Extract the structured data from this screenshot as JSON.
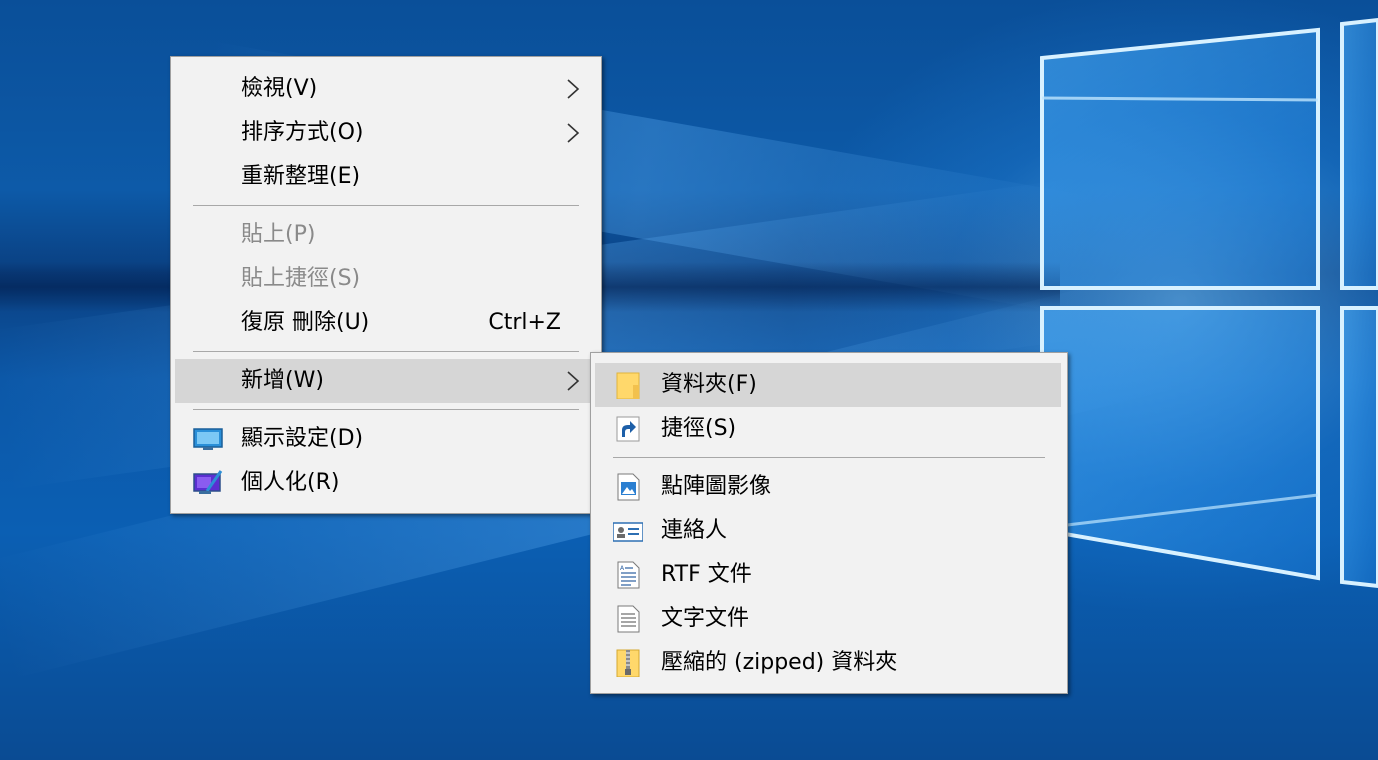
{
  "main_menu": {
    "items": [
      {
        "label": "檢視(V)",
        "has_submenu": true
      },
      {
        "label": "排序方式(O)",
        "has_submenu": true
      },
      {
        "label": "重新整理(E)"
      },
      {
        "label": "貼上(P)",
        "disabled": true
      },
      {
        "label": "貼上捷徑(S)",
        "disabled": true
      },
      {
        "label": "復原 刪除(U)",
        "shortcut": "Ctrl+Z"
      },
      {
        "label": "新增(W)",
        "has_submenu": true,
        "highlighted": true
      },
      {
        "label": "顯示設定(D)",
        "icon": "display-settings-icon"
      },
      {
        "label": "個人化(R)",
        "icon": "personalize-icon"
      }
    ]
  },
  "new_submenu": {
    "items": [
      {
        "label": "資料夾(F)",
        "icon": "folder-icon",
        "highlighted": true
      },
      {
        "label": "捷徑(S)",
        "icon": "shortcut-icon"
      },
      {
        "label": "點陣圖影像",
        "icon": "bitmap-image-icon"
      },
      {
        "label": "連絡人",
        "icon": "contact-icon"
      },
      {
        "label": "RTF 文件",
        "icon": "rtf-document-icon"
      },
      {
        "label": "文字文件",
        "icon": "text-document-icon"
      },
      {
        "label": "壓縮的 (zipped) 資料夾",
        "icon": "zipped-folder-icon"
      }
    ]
  },
  "colors": {
    "menu_background": "#f2f2f2",
    "highlight": "#d6d6d6",
    "disabled_text": "#8a8a8a",
    "separator": "#a8a8a8",
    "desktop": "#0a4f94"
  }
}
